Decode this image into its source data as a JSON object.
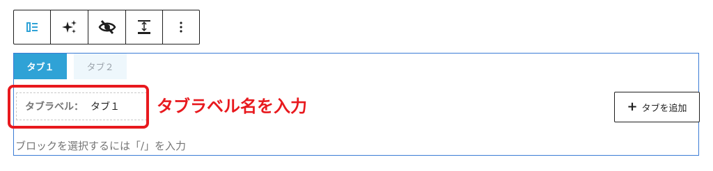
{
  "toolbar": {
    "buttons": [
      {
        "icon": "tab-block-icon"
      },
      {
        "icon": "sparkle-icon"
      },
      {
        "icon": "eye-slash-icon"
      },
      {
        "icon": "spacing-icon"
      },
      {
        "icon": "more-options-icon"
      }
    ]
  },
  "tabs": {
    "items": [
      {
        "label": "タブ１",
        "active": true
      },
      {
        "label": "タブ２",
        "active": false
      }
    ]
  },
  "tab_label": {
    "prefix": "タブラベル：",
    "value": "タブ１"
  },
  "annotation": {
    "text": "タブラベル名を入力",
    "color": "#e8191e"
  },
  "add_tab": {
    "label": "タブを追加"
  },
  "placeholder": {
    "text": "ブロックを選択するには「/」を入力"
  },
  "colors": {
    "active_tab": "#2fa2d6",
    "inactive_tab": "#eef7fc",
    "block_border": "#3a7bd5",
    "highlight": "#e8191e"
  }
}
